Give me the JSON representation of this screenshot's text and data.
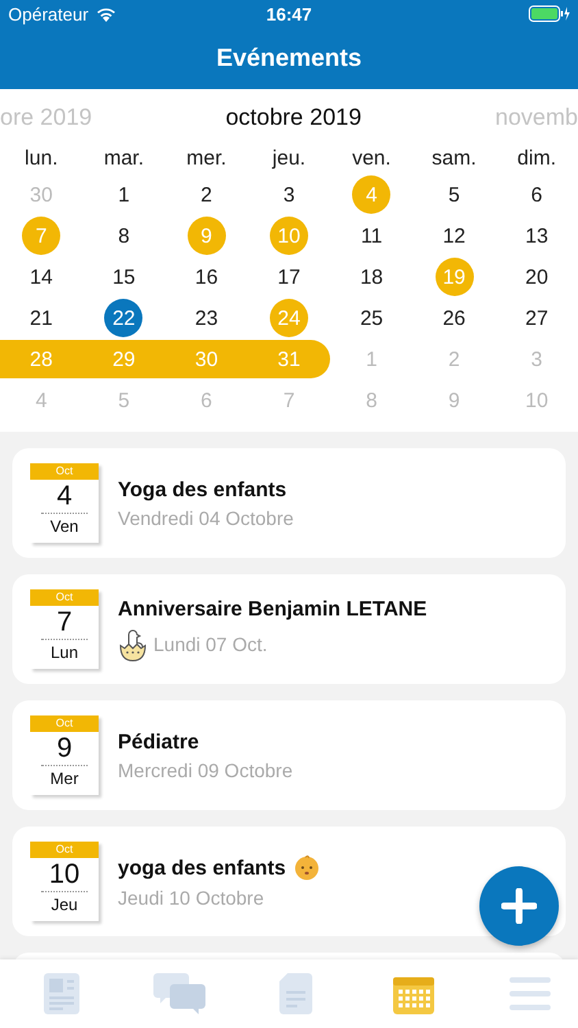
{
  "status_bar": {
    "carrier": "Opérateur",
    "time": "16:47"
  },
  "nav": {
    "title": "Evénements"
  },
  "calendar": {
    "prev_month": "ore 2019",
    "month": "octobre 2019",
    "next_month": "novemb",
    "weekdays": [
      "lun.",
      "mar.",
      "mer.",
      "jeu.",
      "ven.",
      "sam.",
      "dim."
    ],
    "weeks": [
      [
        {
          "day": "30",
          "kind": "outside"
        },
        {
          "day": "1",
          "kind": "normal"
        },
        {
          "day": "2",
          "kind": "normal"
        },
        {
          "day": "3",
          "kind": "normal"
        },
        {
          "day": "4",
          "kind": "event"
        },
        {
          "day": "5",
          "kind": "normal"
        },
        {
          "day": "6",
          "kind": "normal"
        }
      ],
      [
        {
          "day": "7",
          "kind": "event"
        },
        {
          "day": "8",
          "kind": "normal"
        },
        {
          "day": "9",
          "kind": "event"
        },
        {
          "day": "10",
          "kind": "event"
        },
        {
          "day": "11",
          "kind": "normal"
        },
        {
          "day": "12",
          "kind": "normal"
        },
        {
          "day": "13",
          "kind": "normal"
        }
      ],
      [
        {
          "day": "14",
          "kind": "normal"
        },
        {
          "day": "15",
          "kind": "normal"
        },
        {
          "day": "16",
          "kind": "normal"
        },
        {
          "day": "17",
          "kind": "normal"
        },
        {
          "day": "18",
          "kind": "normal"
        },
        {
          "day": "19",
          "kind": "event"
        },
        {
          "day": "20",
          "kind": "normal"
        }
      ],
      [
        {
          "day": "21",
          "kind": "normal"
        },
        {
          "day": "22",
          "kind": "today"
        },
        {
          "day": "23",
          "kind": "normal"
        },
        {
          "day": "24",
          "kind": "event"
        },
        {
          "day": "25",
          "kind": "normal"
        },
        {
          "day": "26",
          "kind": "normal"
        },
        {
          "day": "27",
          "kind": "normal"
        }
      ],
      [
        {
          "day": "28",
          "kind": "range_start"
        },
        {
          "day": "29",
          "kind": "range_mid"
        },
        {
          "day": "30",
          "kind": "range_mid"
        },
        {
          "day": "31",
          "kind": "range_end"
        },
        {
          "day": "1",
          "kind": "outside"
        },
        {
          "day": "2",
          "kind": "outside"
        },
        {
          "day": "3",
          "kind": "outside"
        }
      ],
      [
        {
          "day": "4",
          "kind": "outside"
        },
        {
          "day": "5",
          "kind": "outside"
        },
        {
          "day": "6",
          "kind": "outside"
        },
        {
          "day": "7",
          "kind": "outside"
        },
        {
          "day": "8",
          "kind": "outside"
        },
        {
          "day": "9",
          "kind": "outside"
        },
        {
          "day": "10",
          "kind": "outside"
        }
      ]
    ]
  },
  "events": [
    {
      "month": "Oct",
      "day": "4",
      "weekday": "Ven",
      "title": "Yoga des enfants",
      "date": "Vendredi 04 Octobre"
    },
    {
      "month": "Oct",
      "day": "7",
      "weekday": "Lun",
      "title": "Anniversaire Benjamin LETANE",
      "date": "Lundi 07 Oct.",
      "date_icon": {
        "kind": "chick"
      }
    },
    {
      "month": "Oct",
      "day": "9",
      "weekday": "Mer",
      "title": "Pédiatre",
      "date": "Mercredi 09 Octobre"
    },
    {
      "month": "Oct",
      "day": "10",
      "weekday": "Jeu",
      "title": "yoga des enfants",
      "title_icon": {
        "kind": "baby"
      },
      "date": "Jeudi 10 Octobre"
    }
  ],
  "tab_bar": [
    {
      "kind": "news",
      "selected": false
    },
    {
      "kind": "chat",
      "selected": false
    },
    {
      "kind": "document",
      "selected": false
    },
    {
      "kind": "calendar",
      "selected": true
    },
    {
      "kind": "menu",
      "selected": false
    }
  ]
}
